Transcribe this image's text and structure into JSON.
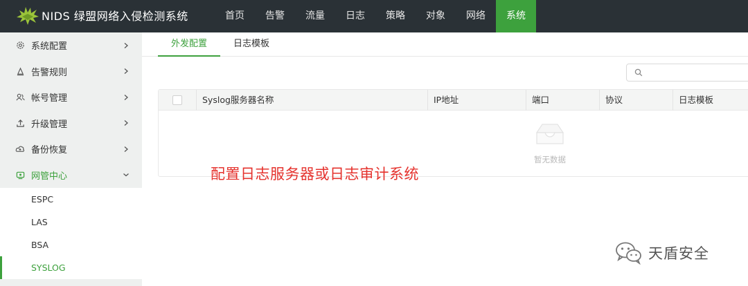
{
  "header": {
    "brand": "NIDS 绿盟网络入侵检测系统",
    "nav": [
      "首页",
      "告警",
      "流量",
      "日志",
      "策略",
      "对象",
      "网络",
      "系统"
    ],
    "active_nav": "系统"
  },
  "sidebar": {
    "items": [
      {
        "label": "系统配置",
        "icon": "gear-icon"
      },
      {
        "label": "告警规则",
        "icon": "alert-rule-icon"
      },
      {
        "label": "帐号管理",
        "icon": "users-icon"
      },
      {
        "label": "升级管理",
        "icon": "upgrade-icon"
      },
      {
        "label": "备份恢复",
        "icon": "backup-cloud-icon"
      },
      {
        "label": "网管中心",
        "icon": "network-center-icon"
      }
    ],
    "subitems": [
      "ESPC",
      "LAS",
      "BSA",
      "SYSLOG"
    ],
    "active_subitem": "SYSLOG"
  },
  "tabs": [
    "外发配置",
    "日志模板"
  ],
  "active_tab": "外发配置",
  "search": {
    "placeholder": ""
  },
  "table": {
    "columns": [
      "Syslog服务器名称",
      "IP地址",
      "端口",
      "协议",
      "日志模板"
    ],
    "rows": [],
    "empty_text": "暂无数据"
  },
  "annotation": "配置日志服务器或日志审计系统",
  "watermark": "天盾安全",
  "colors": {
    "accent": "#3da13d",
    "topbar": "#2a3136",
    "sidebar": "#eef0ef",
    "annotation": "#e5322d"
  }
}
